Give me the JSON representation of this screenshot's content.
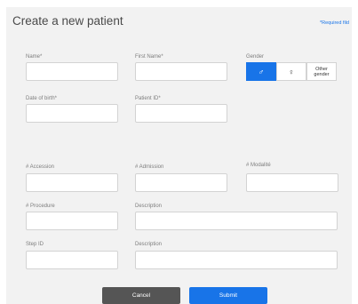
{
  "form": {
    "title": "Create a new patient",
    "required_note": "*Required fild",
    "labels": {
      "name": "Name*",
      "first_name": "First Name*",
      "gender": "Gender",
      "dob": "Date of birth*",
      "patient_id": "Patient ID*",
      "accession": "# Accession",
      "admission": "# Admission",
      "modalite": "# Modalité",
      "procedure": "# Procedure",
      "description1": "Description",
      "step_id": "Step ID",
      "description2": "Description"
    },
    "gender_options": {
      "male_symbol": "♂",
      "female_symbol": "♀",
      "other": "Other\ngender",
      "selected": "male"
    },
    "values": {
      "name": "",
      "first_name": "",
      "dob": "",
      "patient_id": "",
      "accession": "",
      "admission": "",
      "modalite": "",
      "procedure": "",
      "description1": "",
      "step_id": "",
      "description2": ""
    },
    "buttons": {
      "cancel": "Cancel",
      "submit": "Submit"
    },
    "colors": {
      "accent": "#1874e8",
      "cancel": "#555555",
      "panel": "#f2f2f2"
    }
  }
}
